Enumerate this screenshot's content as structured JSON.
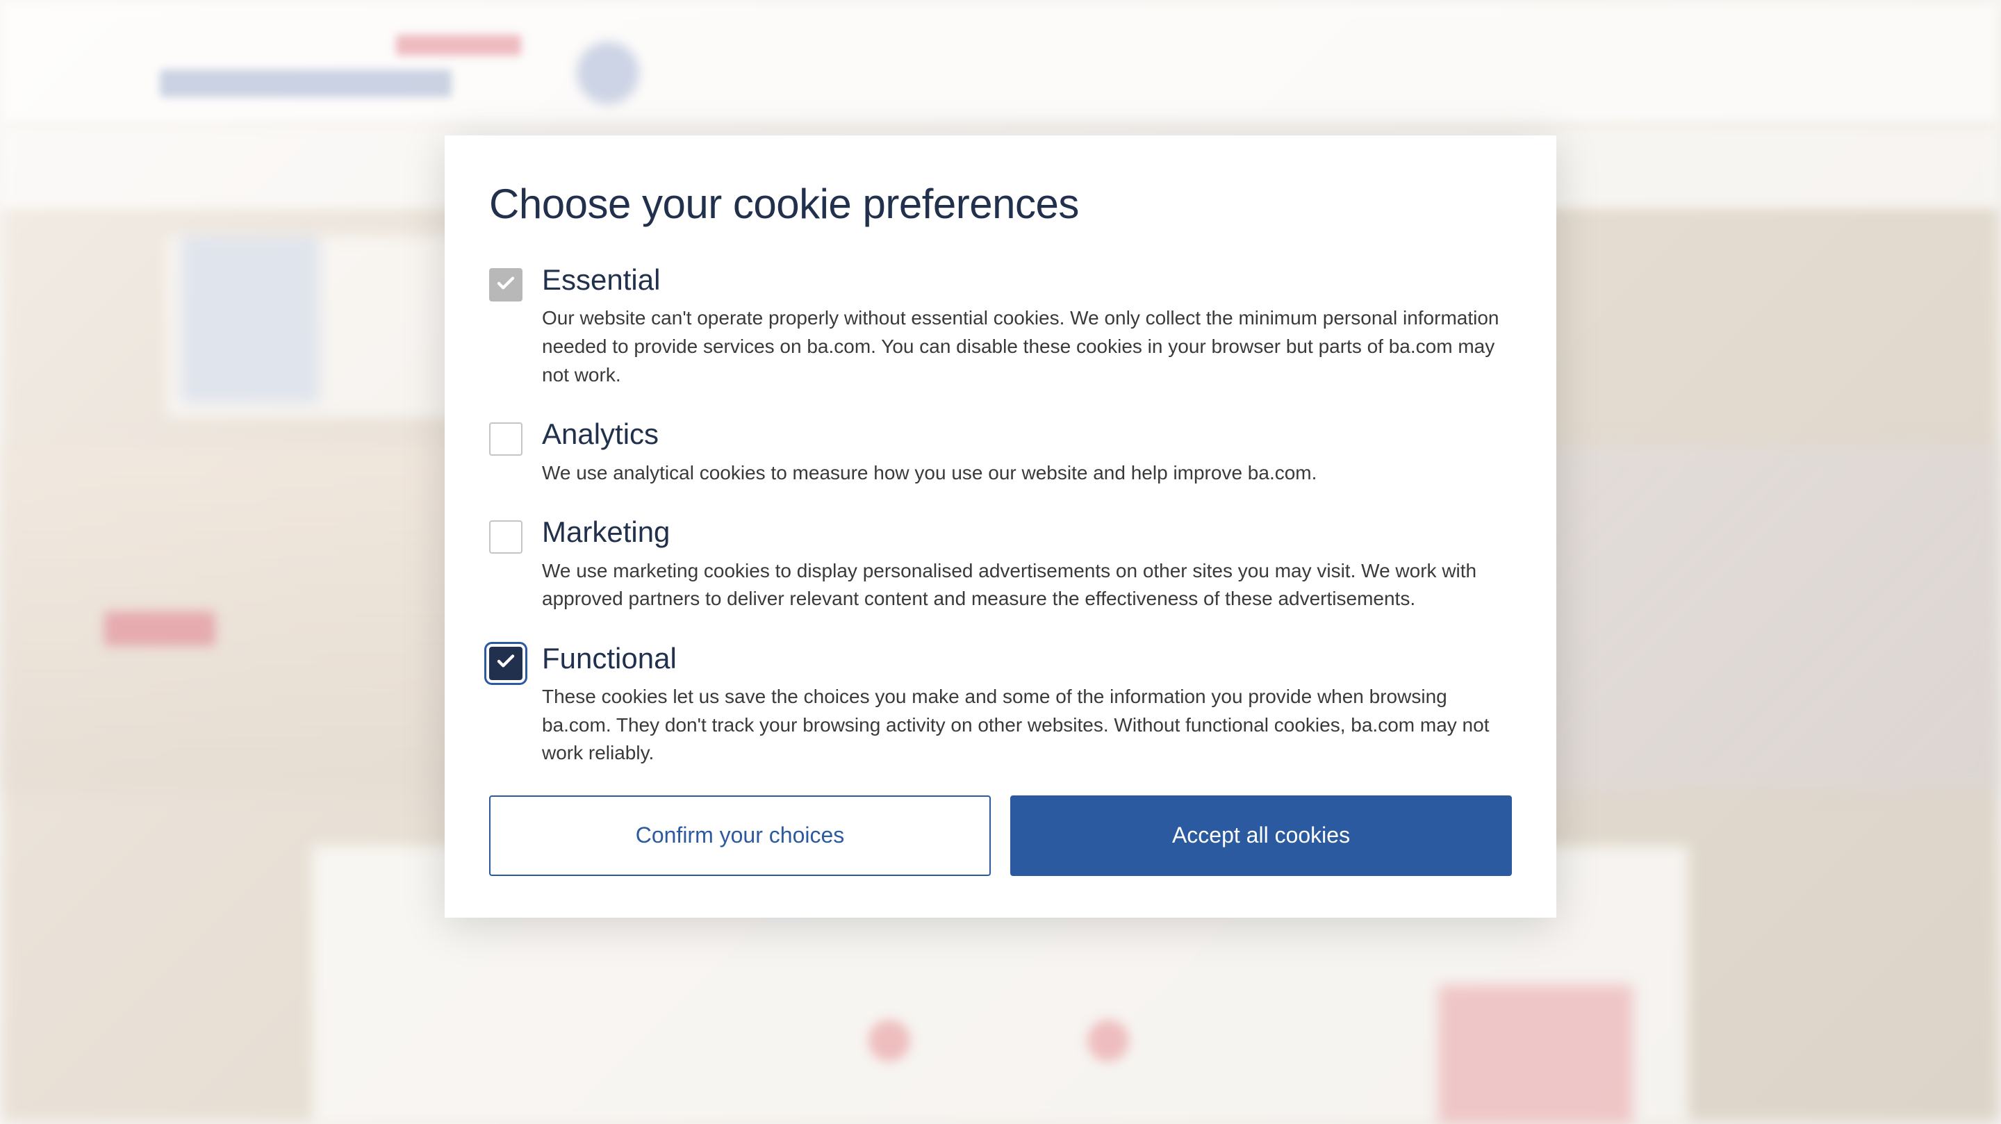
{
  "modal": {
    "title": "Choose your cookie preferences",
    "categories": [
      {
        "key": "essential",
        "title": "Essential",
        "description": "Our website can't operate properly without essential cookies. We only collect the minimum personal information needed to provide services on ba.com. You can disable these cookies in your browser but parts of ba.com may not work.",
        "checked": true,
        "disabled": true,
        "focused": false
      },
      {
        "key": "analytics",
        "title": "Analytics",
        "description": "We use analytical cookies to measure how you use our website and help improve ba.com.",
        "checked": false,
        "disabled": false,
        "focused": false
      },
      {
        "key": "marketing",
        "title": "Marketing",
        "description": "We use marketing cookies to display personalised advertisements on other sites you may visit. We work with approved partners to deliver relevant content and measure the effectiveness of these advertisements.",
        "checked": false,
        "disabled": false,
        "focused": false
      },
      {
        "key": "functional",
        "title": "Functional",
        "description": "These cookies let us save the choices you make and some of the information you provide when browsing ba.com. They don't track your browsing activity on other websites. Without functional cookies, ba.com may not work reliably.",
        "checked": true,
        "disabled": false,
        "focused": true
      }
    ],
    "buttons": {
      "confirm": "Confirm your choices",
      "accept": "Accept all cookies"
    }
  }
}
